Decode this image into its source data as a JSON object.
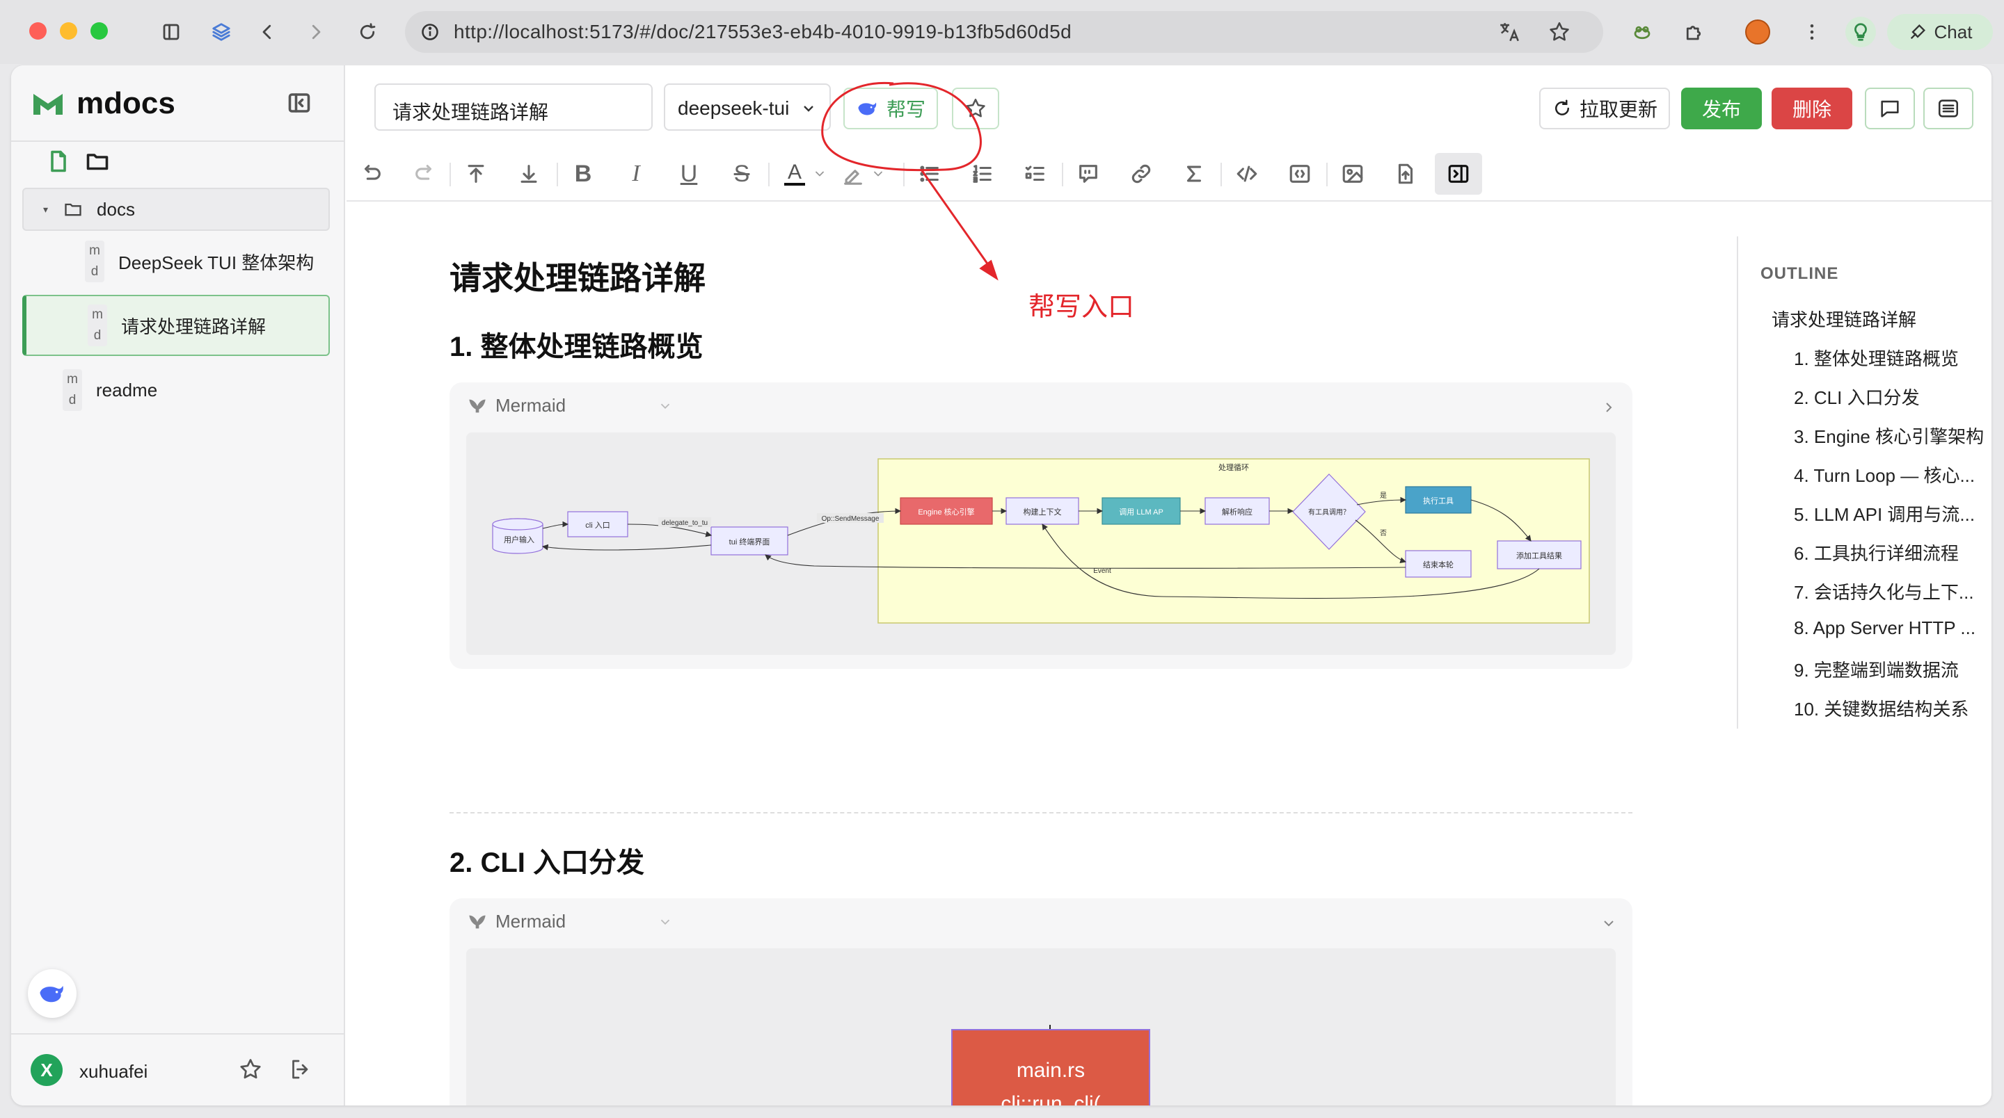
{
  "browser": {
    "url": "http://localhost:5173/#/doc/217553e3-eb4b-4010-9919-b13fb5d60d5d",
    "chat_label": "Chat"
  },
  "sidebar": {
    "brand": "mdocs",
    "tree": [
      {
        "type": "folder",
        "label": "docs"
      },
      {
        "type": "md",
        "label": "DeepSeek TUI 整体架构"
      },
      {
        "type": "md",
        "label": "请求处理链路详解",
        "active": true
      },
      {
        "type": "md",
        "label": "readme"
      }
    ],
    "md_badge_top": "m",
    "md_badge_bottom": "d",
    "user": {
      "initial": "X",
      "name": "xuhuafei",
      "avatar_color": "#22a35a"
    }
  },
  "header": {
    "title_value": "请求处理链路详解",
    "project_select": "deepseek-tui",
    "ai_write_label": "帮写",
    "pull_label": "拉取更新",
    "publish_label": "发布",
    "delete_label": "删除",
    "publish_color": "#3ea94a",
    "delete_color": "#db4545"
  },
  "annotation": {
    "label": "帮写入口",
    "color": "#e3262b"
  },
  "document": {
    "title": "请求处理链路详解",
    "sections": [
      {
        "heading": "1. 整体处理链路概览",
        "block_label": "Mermaid"
      },
      {
        "heading": "2. CLI 入口分发",
        "block_label": "Mermaid"
      }
    ],
    "diagram1": {
      "subgraph_label": "处理循环",
      "nodes": {
        "user": "用户输入",
        "cli": "cli 入口",
        "tui": "tui 终端界面",
        "engine": "Engine 核心引擎",
        "ctx": "构建上下文",
        "llm": "调用 LLM AP",
        "parse": "解析响应",
        "decision": "有工具调用？",
        "exec": "执行工具",
        "end": "结束本轮",
        "add": "添加工具结果"
      },
      "edges": {
        "delegate": "delegate_to_tu",
        "send": "Op::SendMessage",
        "yes": "是",
        "no": "否",
        "event": "Event"
      }
    },
    "diagram2": {
      "line1": "main.rs",
      "line2": "cli::run_cli("
    }
  },
  "outline": {
    "title": "OUTLINE",
    "items": [
      {
        "label": "请求处理链路详解",
        "level": 1
      },
      {
        "label": "1. 整体处理链路概览",
        "level": 2
      },
      {
        "label": "2. CLI 入口分发",
        "level": 2
      },
      {
        "label": "3. Engine 核心引擎架构",
        "level": 2
      },
      {
        "label": "4. Turn Loop — 核心...",
        "level": 2
      },
      {
        "label": "5. LLM API 调用与流...",
        "level": 2
      },
      {
        "label": "6. 工具执行详细流程",
        "level": 2
      },
      {
        "label": "7. 会话持久化与上下...",
        "level": 2
      },
      {
        "label": "8. App Server HTTP ...",
        "level": 2
      },
      {
        "label": "9. 完整端到端数据流",
        "level": 2
      },
      {
        "label": "10. 关键数据结构关系",
        "level": 2
      }
    ]
  }
}
